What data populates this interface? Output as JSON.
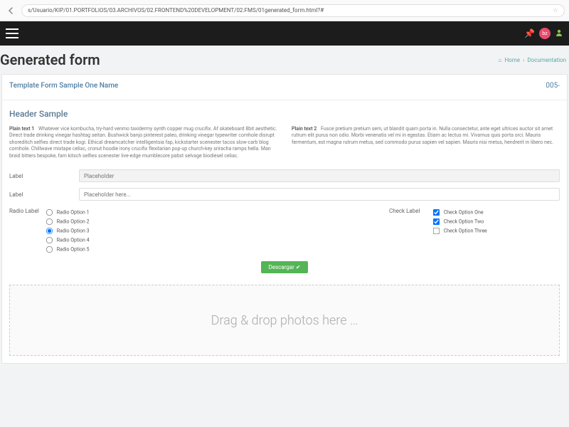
{
  "browser": {
    "url": "s/Usuario/KIP/01.PORTFOLIOS/03.ARCHIVOS/02.FRONTEND%20DEVELOPMENT/02.FMS/01generated_form.html?#"
  },
  "topbar": {
    "badge": "bz"
  },
  "page": {
    "title": "Generated form",
    "breadcrumbs": {
      "home": "Home",
      "doc": "Documentation"
    }
  },
  "meta": {
    "template_name": "Template Form Sample One Name",
    "code": "005-"
  },
  "section": {
    "header": "Header Sample"
  },
  "plain": {
    "col1_label": "Plain text 1",
    "col1_text": "Whatever vice kombucha, try-hard venmo taxidermy synth copper mug crucifix. Af skateboard 8bit aesthetic. Direct trade drinking vinegar hashtag seitan. Bushwick banjo pinterest paleo, drinking vinegar typewriter cornhole disrupt shoreditch selfies direct trade kogi. Ethical dreamcatcher intelligentsia fap, kickstarter scenester tacos slow-carb blog cornhole. Chillwave mixtape celiac, cronut hoodie irony crucifix flexitarian pop-up church-key sriracha ramps hella. Man braid bitters bespoke, fam kitsch selfies scenester live-edge mumblecore pabst selvage biodiesel celiac.",
    "col2_label": "Plain text 2",
    "col2_text": "Fusce pretium pretium sem, ut blandit quam porta in. Nulla consectetur, ante eget ultrices auctor sit amet rutrum elit purus non odio. Morbi venenatis vel mi in egestas. Etiam ac lectus mi. Vivamus quis porta orci. Mauris fermentum, est magna rutrum metus, sed commodo purus sapien vel sapien. Mauris nisi metus, hendrerit in libero nec."
  },
  "inputs": {
    "label1": "Label",
    "placeholder1": "Placeholder",
    "label2": "Label",
    "placeholder2": "Placeholder here..."
  },
  "radio": {
    "label": "Radio Label",
    "options": [
      "Radio Option 1",
      "Radio Option 2",
      "Radio Option 3",
      "Radio Option 4",
      "Radio Option 5"
    ],
    "selected_index": 2
  },
  "check": {
    "label": "Check Label",
    "options": [
      "Check Option One",
      "Check Option Two",
      "Check Option Three"
    ],
    "checked": [
      true,
      true,
      false
    ]
  },
  "button": {
    "label": "Descargar"
  },
  "dropzone": {
    "text": "Drag & drop photos here …"
  }
}
